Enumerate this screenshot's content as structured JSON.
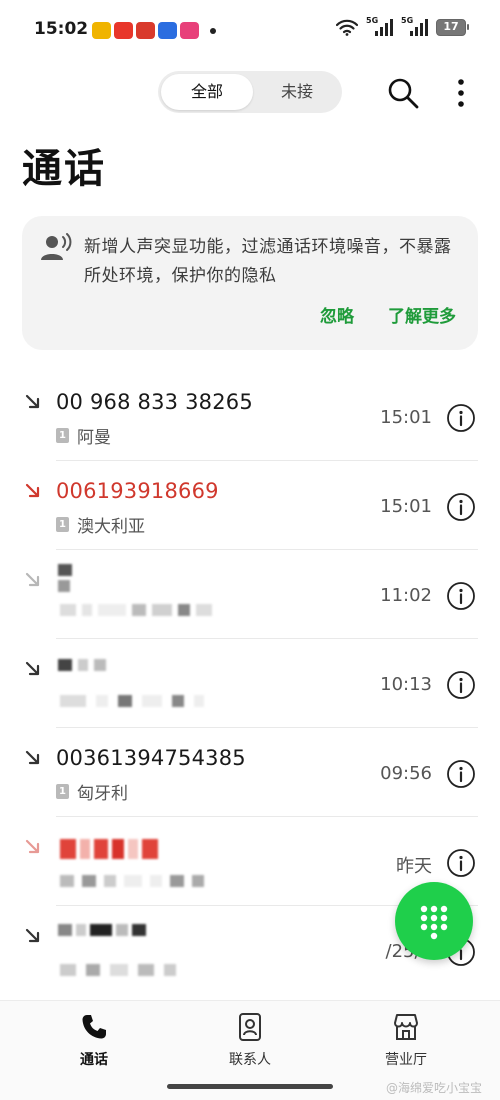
{
  "status_bar": {
    "time": "15:02",
    "app_icon_colors": [
      "#f0b400",
      "#e8362a",
      "#d93a2c",
      "#2b6de0",
      "#e8407a"
    ],
    "signal_1_tag": "5G",
    "signal_2_tag": "5G",
    "battery": "17"
  },
  "toolbar": {
    "tabs": [
      {
        "label": "全部",
        "active": true
      },
      {
        "label": "未接",
        "active": false
      }
    ],
    "search_icon": "search-icon",
    "more_icon": "more-vertical-icon"
  },
  "page": {
    "title": "通话"
  },
  "banner": {
    "icon": "voice-user-icon",
    "text": "新增人声突显功能，过滤通话环境噪音，不暴露所处环境，保护你的隐私",
    "ignore_label": "忽略",
    "learn_more_label": "了解更多",
    "accent_color": "#1f9b3a"
  },
  "calls": [
    {
      "number": "00 968 833 38265",
      "location": "阿曼",
      "sim": "1",
      "time": "15:01",
      "type": "incoming"
    },
    {
      "number": "006193918669",
      "location": "澳大利亚",
      "sim": "1",
      "time": "15:01",
      "type": "missed"
    },
    {
      "number": "",
      "location": "",
      "sim": "",
      "time": "11:02",
      "type": "incoming",
      "redacted": true
    },
    {
      "number": "",
      "location": "",
      "sim": "",
      "time": "10:13",
      "type": "incoming",
      "redacted": true
    },
    {
      "number": "00361394754385",
      "location": "匈牙利",
      "sim": "1",
      "time": "09:56",
      "type": "incoming"
    },
    {
      "number": "",
      "location": "",
      "sim": "",
      "time": "昨天",
      "type": "missed",
      "redacted": true
    },
    {
      "number": "",
      "location": "",
      "sim": "",
      "time": "/25/1",
      "type": "incoming",
      "redacted": true
    }
  ],
  "colors": {
    "missed": "#d0382d",
    "fab": "#1fcf4b"
  },
  "fab": {
    "icon": "dialpad-icon"
  },
  "bottom_nav": {
    "items": [
      {
        "label": "通话",
        "icon": "phone-icon",
        "active": true
      },
      {
        "label": "联系人",
        "icon": "contact-card-icon",
        "active": false
      },
      {
        "label": "营业厅",
        "icon": "store-icon",
        "active": false
      }
    ]
  },
  "watermark": "@海绵爱吃小宝宝"
}
